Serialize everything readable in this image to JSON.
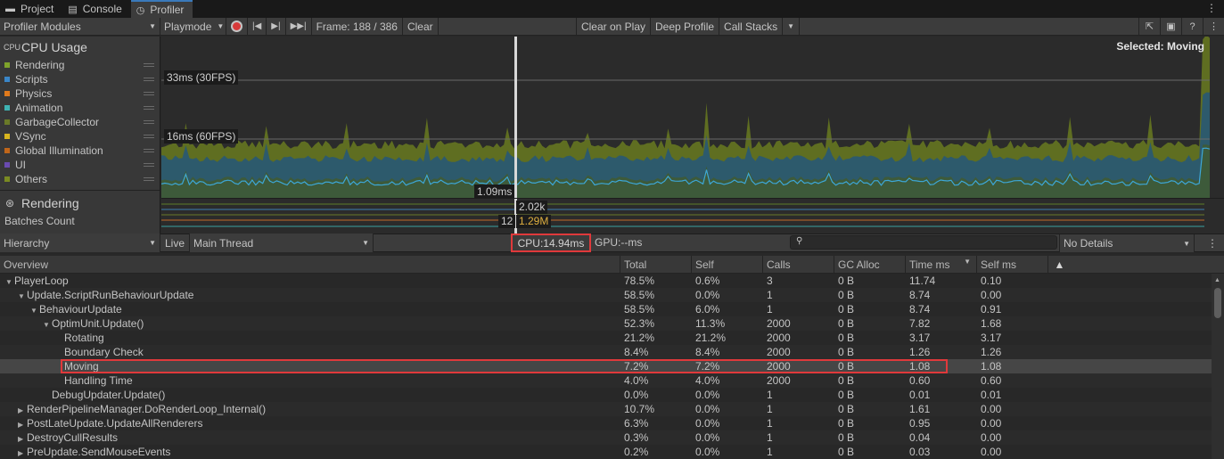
{
  "tabs": [
    {
      "label": "Project",
      "icon": "folder-icon"
    },
    {
      "label": "Console",
      "icon": "console-icon"
    },
    {
      "label": "Profiler",
      "icon": "profiler-icon",
      "active": true
    }
  ],
  "toolbar": {
    "modules_dropdown": "Profiler Modules",
    "target_dropdown": "Playmode",
    "frame_label": "Frame: 188 / 386",
    "clear": "Clear",
    "clear_on_play": "Clear on Play",
    "deep_profile": "Deep Profile",
    "call_stacks": "Call Stacks"
  },
  "modules": {
    "cpu_title": "CPU Usage",
    "cpu_items": [
      {
        "label": "Rendering",
        "color": "#7fa32b"
      },
      {
        "label": "Scripts",
        "color": "#3a86c8"
      },
      {
        "label": "Physics",
        "color": "#e07a1c"
      },
      {
        "label": "Animation",
        "color": "#3fb3b3"
      },
      {
        "label": "GarbageCollector",
        "color": "#6a7a28"
      },
      {
        "label": "VSync",
        "color": "#d8b51f"
      },
      {
        "label": "Global Illumination",
        "color": "#c0661a"
      },
      {
        "label": "UI",
        "color": "#6a4bb0"
      },
      {
        "label": "Others",
        "color": "#7a8a22"
      }
    ],
    "rendering_title": "Rendering",
    "rendering_sub": "Batches Count"
  },
  "chart": {
    "label_33": "33ms (30FPS)",
    "label_16": "16ms (60FPS)",
    "selected": "Selected: Moving",
    "cursor_value": "1.09ms",
    "strip_v1": "2.02k",
    "strip_v2": "12",
    "strip_v3": "1.29M"
  },
  "hierarchy_bar": {
    "view": "Hierarchy",
    "live": "Live",
    "thread": "Main Thread",
    "cpu": "CPU:14.94ms",
    "gpu": "GPU:--ms",
    "details": "No Details"
  },
  "table": {
    "columns": [
      "Overview",
      "Total",
      "Self",
      "Calls",
      "GC Alloc",
      "Time ms",
      "Self ms"
    ],
    "rows": [
      {
        "name": "PlayerLoop",
        "indent": 0,
        "tri": "down",
        "total": "78.5%",
        "self": "0.6%",
        "calls": "3",
        "gc": "0 B",
        "time": "11.74",
        "selfms": "0.10"
      },
      {
        "name": "Update.ScriptRunBehaviourUpdate",
        "indent": 1,
        "tri": "down",
        "total": "58.5%",
        "self": "0.0%",
        "calls": "1",
        "gc": "0 B",
        "time": "8.74",
        "selfms": "0.00"
      },
      {
        "name": "BehaviourUpdate",
        "indent": 2,
        "tri": "down",
        "total": "58.5%",
        "self": "6.0%",
        "calls": "1",
        "gc": "0 B",
        "time": "8.74",
        "selfms": "0.91"
      },
      {
        "name": "OptimUnit.Update()",
        "indent": 3,
        "tri": "down",
        "total": "52.3%",
        "self": "11.3%",
        "calls": "2000",
        "gc": "0 B",
        "time": "7.82",
        "selfms": "1.68"
      },
      {
        "name": "Rotating",
        "indent": 4,
        "tri": "",
        "total": "21.2%",
        "self": "21.2%",
        "calls": "2000",
        "gc": "0 B",
        "time": "3.17",
        "selfms": "3.17"
      },
      {
        "name": "Boundary Check",
        "indent": 4,
        "tri": "",
        "total": "8.4%",
        "self": "8.4%",
        "calls": "2000",
        "gc": "0 B",
        "time": "1.26",
        "selfms": "1.26"
      },
      {
        "name": "Moving",
        "indent": 4,
        "tri": "",
        "total": "7.2%",
        "self": "7.2%",
        "calls": "2000",
        "gc": "0 B",
        "time": "1.08",
        "selfms": "1.08",
        "selected": true
      },
      {
        "name": "Handling Time",
        "indent": 4,
        "tri": "",
        "total": "4.0%",
        "self": "4.0%",
        "calls": "2000",
        "gc": "0 B",
        "time": "0.60",
        "selfms": "0.60"
      },
      {
        "name": "DebugUpdater.Update()",
        "indent": 3,
        "tri": "",
        "total": "0.0%",
        "self": "0.0%",
        "calls": "1",
        "gc": "0 B",
        "time": "0.01",
        "selfms": "0.01"
      },
      {
        "name": "RenderPipelineManager.DoRenderLoop_Internal()",
        "indent": 1,
        "tri": "right",
        "total": "10.7%",
        "self": "0.0%",
        "calls": "1",
        "gc": "0 B",
        "time": "1.61",
        "selfms": "0.00"
      },
      {
        "name": "PostLateUpdate.UpdateAllRenderers",
        "indent": 1,
        "tri": "right",
        "total": "6.3%",
        "self": "0.0%",
        "calls": "1",
        "gc": "0 B",
        "time": "0.95",
        "selfms": "0.00"
      },
      {
        "name": "DestroyCullResults",
        "indent": 1,
        "tri": "right",
        "total": "0.3%",
        "self": "0.0%",
        "calls": "1",
        "gc": "0 B",
        "time": "0.04",
        "selfms": "0.00"
      },
      {
        "name": "PreUpdate.SendMouseEvents",
        "indent": 1,
        "tri": "right",
        "total": "0.2%",
        "self": "0.0%",
        "calls": "1",
        "gc": "0 B",
        "time": "0.03",
        "selfms": "0.00"
      }
    ]
  }
}
